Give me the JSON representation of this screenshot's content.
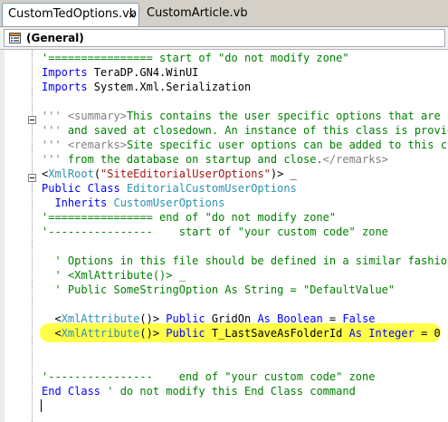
{
  "tabs": [
    {
      "label": "CustomTedOptions.vb",
      "active": true
    },
    {
      "label": "CustomArticle.vb",
      "active": false
    }
  ],
  "tab_close_glyph": "×",
  "navigation": {
    "selected": "(General)"
  },
  "code_lines": [
    {
      "parts": [
        {
          "t": "'================ start of \"do not modify zone\"",
          "c": "cm"
        }
      ]
    },
    {
      "parts": [
        {
          "t": "Imports",
          "c": "kw"
        },
        {
          "t": " TeraDP.GN4.WinUI",
          "c": ""
        }
      ]
    },
    {
      "parts": [
        {
          "t": "Imports",
          "c": "kw"
        },
        {
          "t": " System.Xml.Serialization",
          "c": ""
        }
      ]
    },
    {
      "parts": []
    },
    {
      "parts": [
        {
          "t": "'''",
          "c": "xd"
        },
        {
          "t": " ",
          "c": "cm"
        },
        {
          "t": "<summary>",
          "c": "xd"
        },
        {
          "t": "This contains the user specific options that are loa",
          "c": "cm"
        }
      ]
    },
    {
      "parts": [
        {
          "t": "'''",
          "c": "xd"
        },
        {
          "t": " and saved at closedown. An instance of this class is provided",
          "c": "cm"
        }
      ]
    },
    {
      "parts": [
        {
          "t": "'''",
          "c": "xd"
        },
        {
          "t": " ",
          "c": "cm"
        },
        {
          "t": "<remarks>",
          "c": "xd"
        },
        {
          "t": "Site specific user options can be added to this class",
          "c": "cm"
        }
      ]
    },
    {
      "parts": [
        {
          "t": "'''",
          "c": "xd"
        },
        {
          "t": " from the database on startup and close.",
          "c": "cm"
        },
        {
          "t": "</remarks>",
          "c": "xd"
        }
      ]
    },
    {
      "parts": [
        {
          "t": "<",
          "c": ""
        },
        {
          "t": "XmlRoot",
          "c": "ty"
        },
        {
          "t": "(",
          "c": ""
        },
        {
          "t": "\"SiteEditorialUserOptions\"",
          "c": "st"
        },
        {
          "t": ")> _",
          "c": ""
        }
      ]
    },
    {
      "parts": [
        {
          "t": "Public Class",
          "c": "kw"
        },
        {
          "t": " ",
          "c": ""
        },
        {
          "t": "EditorialCustomUserOptions",
          "c": "ty"
        }
      ]
    },
    {
      "parts": [
        {
          "t": "  Inherits",
          "c": "kw"
        },
        {
          "t": " ",
          "c": ""
        },
        {
          "t": "CustomUserOptions",
          "c": "ty"
        }
      ]
    },
    {
      "parts": [
        {
          "t": "'================ end of \"do not modify zone\"",
          "c": "cm"
        }
      ]
    },
    {
      "parts": [
        {
          "t": "'----------------    start of \"your custom code\" zone",
          "c": "cm"
        }
      ]
    },
    {
      "parts": []
    },
    {
      "parts": [
        {
          "t": "  ' Options in this file should be defined in a similar fashion t",
          "c": "cm"
        }
      ]
    },
    {
      "parts": [
        {
          "t": "  ' <XmlAttribute()> _",
          "c": "cm"
        }
      ]
    },
    {
      "parts": [
        {
          "t": "  ' Public SomeStringOption As String = \"DefaultValue\"",
          "c": "cm"
        }
      ]
    },
    {
      "parts": []
    },
    {
      "parts": [
        {
          "t": "  <",
          "c": ""
        },
        {
          "t": "XmlAttribute",
          "c": "ty"
        },
        {
          "t": "()> ",
          "c": ""
        },
        {
          "t": "Public",
          "c": "kw"
        },
        {
          "t": " GridOn ",
          "c": ""
        },
        {
          "t": "As Boolean",
          "c": "kw"
        },
        {
          "t": " = ",
          "c": ""
        },
        {
          "t": "False",
          "c": "kw"
        }
      ]
    },
    {
      "parts": [
        {
          "t": "  <",
          "c": ""
        },
        {
          "t": "XmlAttribute",
          "c": "ty"
        },
        {
          "t": "()> ",
          "c": ""
        },
        {
          "t": "Public",
          "c": "kw"
        },
        {
          "t": " T_LastSaveAsFolderId ",
          "c": ""
        },
        {
          "t": "As Integer",
          "c": "kw"
        },
        {
          "t": " = 0",
          "c": ""
        }
      ]
    },
    {
      "parts": []
    },
    {
      "parts": []
    },
    {
      "parts": [
        {
          "t": "'----------------    end of \"your custom code\" zone",
          "c": "cm"
        }
      ]
    },
    {
      "parts": [
        {
          "t": "End Class",
          "c": "kw"
        },
        {
          "t": " ' do not modify this End Class command",
          "c": "cm"
        }
      ]
    }
  ],
  "highlight": {
    "line_index": 19,
    "color": "#ffff33"
  },
  "colors": {
    "keyword": "#0000ff",
    "type": "#2b91af",
    "comment": "#008000",
    "string": "#a31515",
    "xmldoc": "#808080",
    "highlight": "#ffff33"
  }
}
